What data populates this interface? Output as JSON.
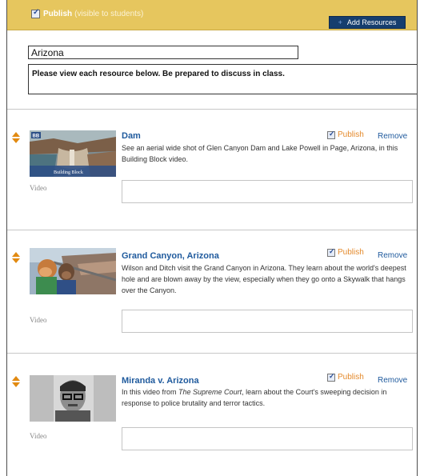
{
  "header": {
    "publish_label": "Publish",
    "publish_note": "(visible to students)",
    "publish_checked": true,
    "add_button_plus": "+",
    "add_button_label": "Add Resources"
  },
  "collection": {
    "title_value": "Arizona",
    "description_value": "Please view each resource below. Be prepared to discuss in class."
  },
  "items": [
    {
      "title": "Dam",
      "description": "See an aerial wide shot of Glen Canyon Dam and Lake Powell in Page, Arizona, in this Building Block video.",
      "media_type": "Video",
      "publish_label": "Publish",
      "publish_checked": true,
      "remove_label": "Remove",
      "thumb_badge": "BB",
      "thumb_caption": "Building Block"
    },
    {
      "title": "Grand Canyon, Arizona",
      "description": "Wilson and Ditch visit the Grand Canyon in Arizona. They learn about the world's deepest hole and are blown away by the view, especially when they go onto a Skywalk that hangs over the Canyon.",
      "media_type": "Video",
      "publish_label": "Publish",
      "publish_checked": true,
      "remove_label": "Remove"
    },
    {
      "title": "Miranda v. Arizona",
      "description_pre": "In this video from ",
      "description_italic": "The Supreme Court",
      "description_post": ", learn about the Court's sweeping decision in response to police brutality and terror tactics.",
      "media_type": "Video",
      "publish_label": "Publish",
      "publish_checked": true,
      "remove_label": "Remove"
    }
  ],
  "colors": {
    "header_bar": "#e6c65e",
    "add_button": "#163e6e",
    "link_blue": "#1f5a9d",
    "publish_orange": "#e48a2c",
    "sort_arrow": "#e28a12"
  }
}
